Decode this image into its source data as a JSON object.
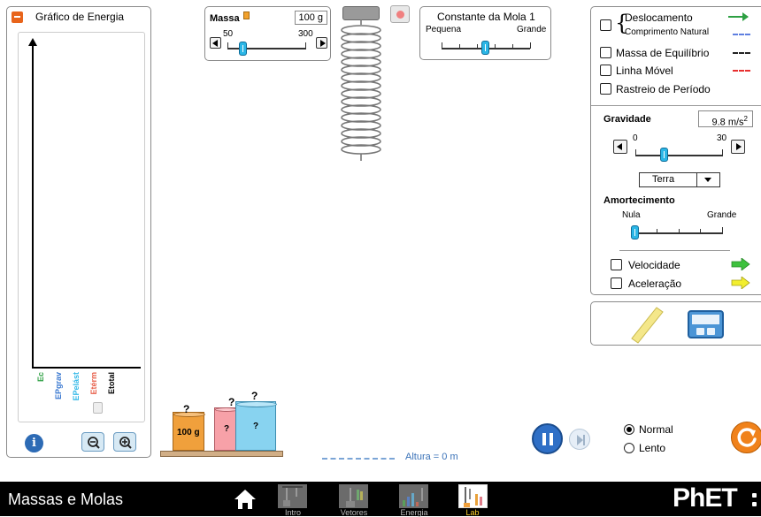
{
  "energy_graph": {
    "title": "Gráfico de Energia",
    "bars": [
      {
        "label": "Ec",
        "color": "#2ea043"
      },
      {
        "label": "EPgrav",
        "color": "#3a78d0"
      },
      {
        "label": "EPelást",
        "color": "#35b9e8"
      },
      {
        "label": "Etérm",
        "color": "#e8604b"
      },
      {
        "label": "Etotal",
        "color": "#000000"
      }
    ]
  },
  "mass_panel": {
    "label": "Massa",
    "value": "100 g",
    "min": "50",
    "max": "300",
    "level_fraction": 0.2
  },
  "spring_panel": {
    "title": "Constante da Mola 1",
    "min_label": "Pequena",
    "max_label": "Grande",
    "level_fraction": 0.5
  },
  "options_panel": {
    "displacement": "Deslocamento",
    "natural_length": "Comprimento Natural",
    "equilibrium": "Massa de Equilíbrio",
    "moving_line": "Linha Móvel",
    "period_trace": "Rastreio de Período"
  },
  "gravity_panel": {
    "label": "Gravidade",
    "value": "9.8 m/s",
    "value_sup": "2",
    "min": "0",
    "max": "30",
    "level_fraction": 0.33,
    "planet": "Terra"
  },
  "damping_panel": {
    "label": "Amortecimento",
    "min": "Nula",
    "max": "Grande",
    "level_fraction": 0.0
  },
  "vectors": {
    "velocity": "Velocidade",
    "acceleration": "Aceleração"
  },
  "masses": {
    "known": "100 g",
    "unknown_mark": "?"
  },
  "height_label": "Altura = 0 m",
  "speed": {
    "normal": "Normal",
    "slow": "Lento"
  },
  "footer": {
    "app_title": "Massas e Molas",
    "tabs": [
      "Intro",
      "Vetores",
      "Energia",
      "Lab"
    ],
    "brand": "PhET"
  }
}
